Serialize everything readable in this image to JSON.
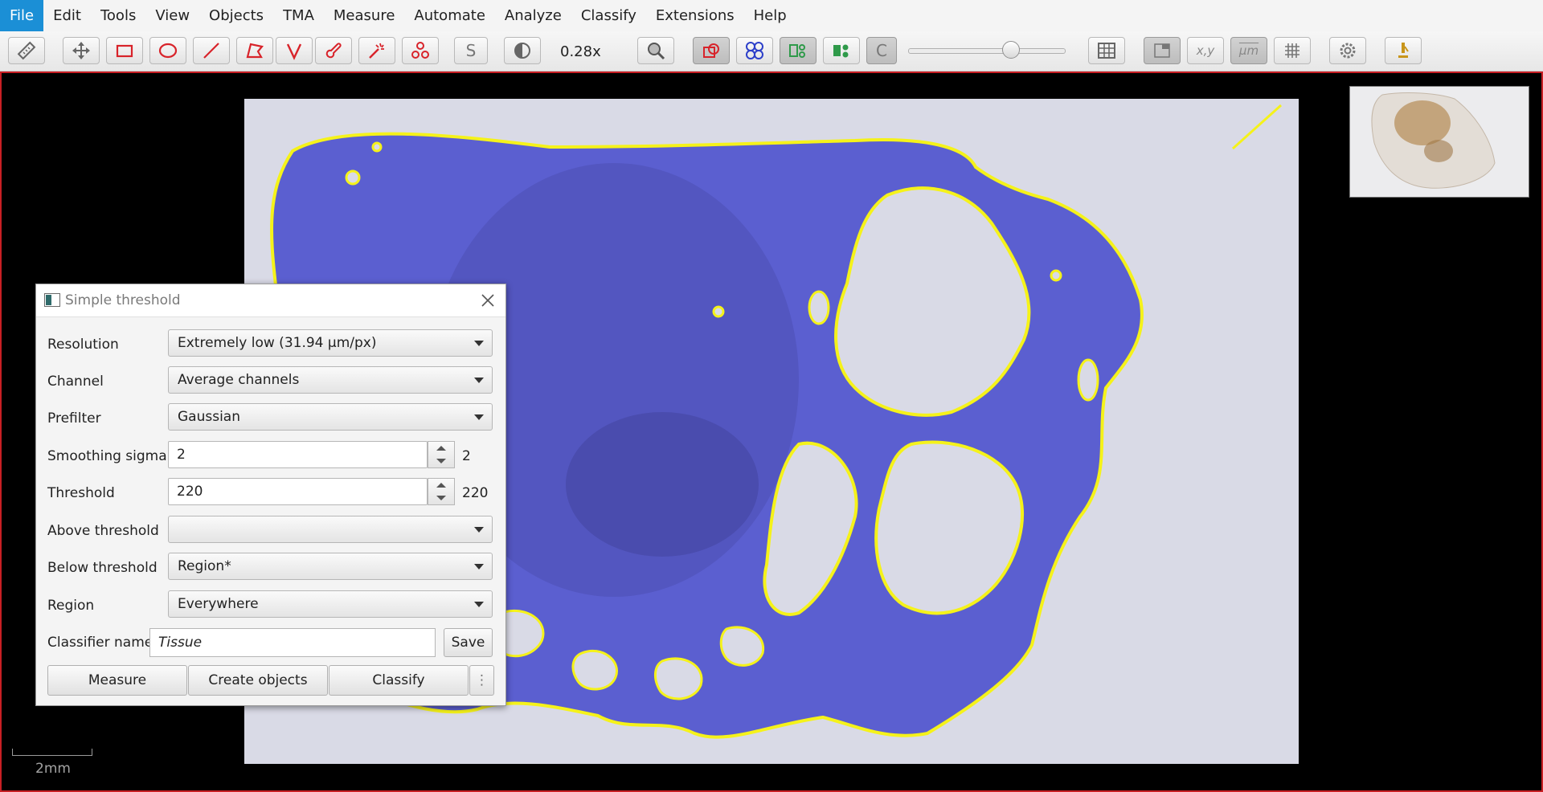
{
  "menu": [
    "File",
    "Edit",
    "Tools",
    "View",
    "Objects",
    "TMA",
    "Measure",
    "Automate",
    "Analyze",
    "Classify",
    "Extensions",
    "Help"
  ],
  "toolbar": {
    "zoom": "0.28x",
    "icons": [
      "ruler-icon",
      "move-icon",
      "rectangle-icon",
      "ellipse-icon",
      "line-icon",
      "polygon-icon",
      "polyline-icon",
      "brush-icon",
      "wand-icon",
      "points-icon",
      "selection-mode-icon",
      "brightness-contrast-icon",
      "zoom-to-fit-icon",
      "show-annotations-icon",
      "show-tma-grid-icon",
      "show-detections-icon",
      "fill-detections-icon",
      "show-pixel-classification-icon",
      "opacity-slider",
      "measurement-table-icon",
      "overview-icon",
      "location-icon",
      "scalebar-icon",
      "grid-icon",
      "preferences-icon",
      "log-icon"
    ],
    "selection_mode_label": "S",
    "pixel_class_label": "C",
    "location_label": "x,y",
    "scalebar_label": "µm"
  },
  "viewer": {
    "scalebar_label": "2mm"
  },
  "colors": {
    "accent": "#1b8fd6",
    "overlay_fill": "#5b5fd0",
    "overlay_outline": "#f5f21a",
    "viewer_border": "#c81f24"
  },
  "dialog": {
    "title": "Simple threshold",
    "rows": {
      "resolution": {
        "label": "Resolution",
        "value": "Extremely low (31.94 µm/px)"
      },
      "channel": {
        "label": "Channel",
        "value": "Average channels"
      },
      "prefilter": {
        "label": "Prefilter",
        "value": "Gaussian"
      },
      "smoothing": {
        "label": "Smoothing sigma",
        "value": "2",
        "display": "2"
      },
      "threshold": {
        "label": "Threshold",
        "value": "220",
        "display": "220"
      },
      "above": {
        "label": "Above threshold",
        "value": ""
      },
      "below": {
        "label": "Below threshold",
        "value": "Region*"
      },
      "region": {
        "label": "Region",
        "value": "Everywhere"
      }
    },
    "classifier_name_label": "Classifier name",
    "classifier_name": "Tissue",
    "save_label": "Save",
    "buttons": {
      "measure": "Measure",
      "create_objects": "Create objects",
      "classify": "Classify",
      "more": "⋮"
    }
  }
}
